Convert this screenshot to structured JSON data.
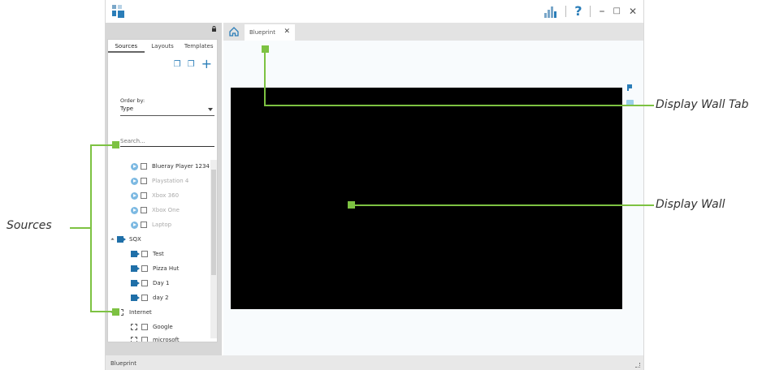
{
  "window": {
    "status_title": "Blueprint"
  },
  "sidebar": {
    "tabs": [
      {
        "label": "Sources"
      },
      {
        "label": "Layouts"
      },
      {
        "label": "Templates"
      }
    ],
    "order_label": "Order by:",
    "order_value": "Type",
    "search_placeholder": "Search...",
    "tree": [
      {
        "label": "Blueray Player 1234"
      },
      {
        "label": "Playstation 4"
      },
      {
        "label": "Xbox 360"
      },
      {
        "label": "Xbox One"
      },
      {
        "label": "Laptop"
      },
      {
        "label": "SQX"
      },
      {
        "label": "Test"
      },
      {
        "label": "Pizza Hut"
      },
      {
        "label": "Day 1"
      },
      {
        "label": "day 2"
      },
      {
        "label": "Internet"
      },
      {
        "label": "Google"
      },
      {
        "label": "microsoft"
      }
    ]
  },
  "doc_tabs": {
    "blueprint_label": "Blueprint",
    "close_glyph": "✕"
  },
  "annotations": {
    "sources": "Sources",
    "display_wall_tab": "Display Wall Tab",
    "display_wall": "Display Wall"
  },
  "colors": {
    "accent": "#2a7db8",
    "callout_green": "#7dc242",
    "wall": "#000000"
  }
}
